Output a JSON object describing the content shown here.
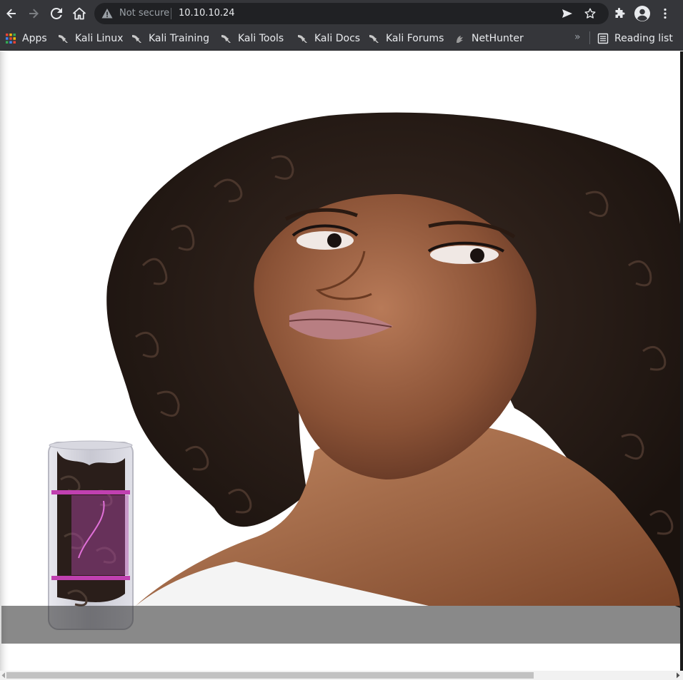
{
  "browser": {
    "security_label": "Not secure",
    "url": "10.10.10.24"
  },
  "bookmarks": {
    "apps_label": "Apps",
    "items": [
      {
        "label": "Kali Linux"
      },
      {
        "label": "Kali Training"
      },
      {
        "label": "Kali Tools"
      },
      {
        "label": "Kali Docs"
      },
      {
        "label": "Kali Forums"
      },
      {
        "label": "NetHunter"
      }
    ],
    "more_label": "»",
    "reading_list_label": "Reading list"
  },
  "page": {
    "hero_image": "curly-hair-model-with-hair-product-photo"
  },
  "colors": {
    "chrome_bg": "#35363a",
    "omnibox_bg": "#202124",
    "chrome_text": "#e8eaed",
    "muted_text": "#9aa0a6"
  }
}
